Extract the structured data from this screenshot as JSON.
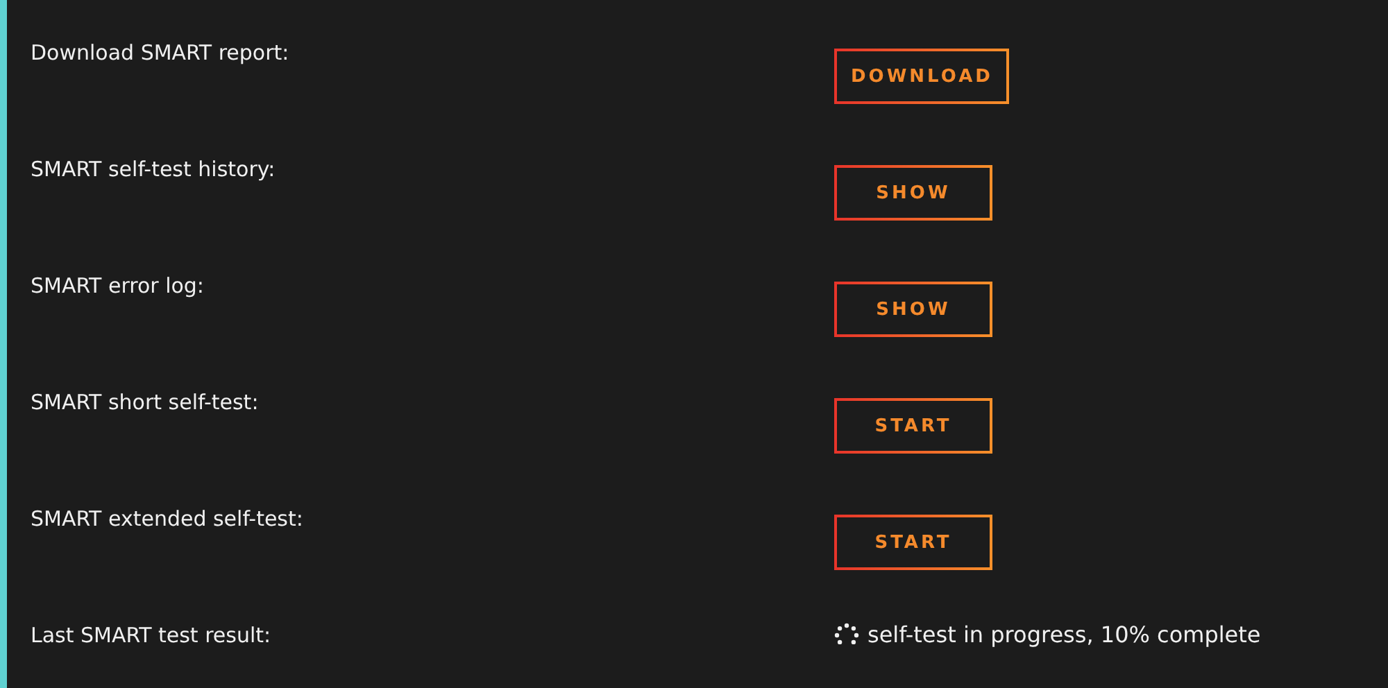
{
  "rows": [
    {
      "label": "Download SMART report:",
      "kind": "button",
      "button": "DOWNLOAD"
    },
    {
      "label": "SMART self-test history:",
      "kind": "button",
      "button": "SHOW"
    },
    {
      "label": "SMART error log:",
      "kind": "button",
      "button": "SHOW"
    },
    {
      "label": "SMART short self-test:",
      "kind": "button",
      "button": "START"
    },
    {
      "label": "SMART extended self-test:",
      "kind": "button",
      "button": "START"
    },
    {
      "label": "Last SMART test result:",
      "kind": "status",
      "status": "self-test in progress, 10% complete"
    }
  ]
}
